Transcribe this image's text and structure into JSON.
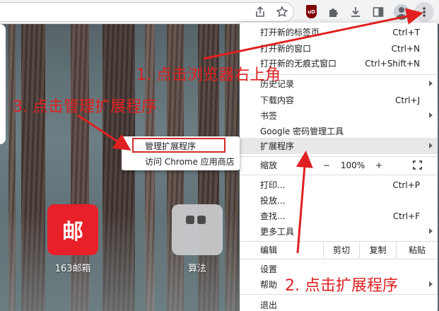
{
  "toolbar": {
    "icons": [
      "share-icon",
      "star-icon",
      "ublock-icon",
      "puzzle-icon",
      "download-icon",
      "sidepanel-icon",
      "avatar-icon",
      "kebab-icon"
    ],
    "ublock_label": "uD"
  },
  "shortcuts": [
    {
      "label": "163邮箱",
      "glyph": "邮"
    },
    {
      "label": "算法"
    }
  ],
  "menu": {
    "items": {
      "new_tab": {
        "label": "打开新的标签页",
        "shortcut": "Ctrl+T"
      },
      "new_window": {
        "label": "打开新的窗口",
        "shortcut": "Ctrl+N"
      },
      "incognito": {
        "label": "打开新的无痕式窗口",
        "shortcut": "Ctrl+Shift+N"
      },
      "history": {
        "label": "历史记录"
      },
      "downloads": {
        "label": "下载内容",
        "shortcut": "Ctrl+J"
      },
      "bookmarks": {
        "label": "书签"
      },
      "password_manager": {
        "label": "Google 密码管理工具"
      },
      "extensions": {
        "label": "扩展程序"
      },
      "print": {
        "label": "打印...",
        "shortcut": "Ctrl+P"
      },
      "cast": {
        "label": "投放..."
      },
      "find": {
        "label": "查找...",
        "shortcut": "Ctrl+F"
      },
      "more_tools": {
        "label": "更多工具"
      },
      "settings": {
        "label": "设置"
      },
      "help": {
        "label": "帮助"
      },
      "exit": {
        "label": "退出"
      }
    },
    "zoom": {
      "label": "缩放",
      "minus": "−",
      "value": "100%",
      "plus": "+"
    },
    "edit": {
      "label": "编辑",
      "cut": "剪切",
      "copy": "复制",
      "paste": "粘贴"
    }
  },
  "submenu": {
    "manage": "管理扩展程序",
    "webstore": "访问 Chrome 应用商店"
  },
  "annotations": {
    "step1": "1. 点击浏览器右上角",
    "step2": "2. 点击扩展程序",
    "step3": "3. 点击管理扩展程序"
  },
  "colors": {
    "annotation": "#e02020",
    "menu_highlight": "#e8e8e9",
    "mail_tile": "#e8202a"
  }
}
